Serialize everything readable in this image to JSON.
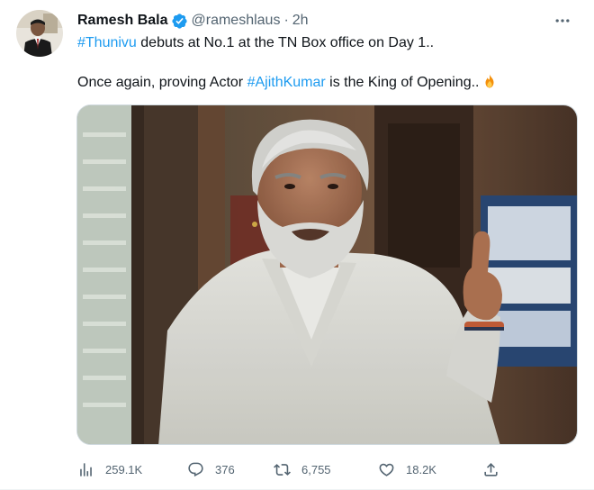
{
  "tweet": {
    "author_name": "Ramesh Bala",
    "author_handle": "@rameshlaus",
    "separator": "·",
    "timestamp": "2h",
    "verified": true,
    "text_line1": {
      "hashtag": "#Thunivu",
      "rest": " debuts at No.1 at the TN Box office on Day 1.."
    },
    "text_line2": {
      "prefix": "Once again, proving Actor ",
      "hashtag": "#AjithKumar",
      "suffix": " is the King of Opening.."
    },
    "emoji": "fire-emoji",
    "media": {
      "kind": "photo"
    },
    "stats": {
      "views": "259.1K",
      "replies": "376",
      "retweets": "6,755",
      "likes": "18.2K"
    }
  },
  "icons": {
    "verified": "verified-badge-icon",
    "more": "more-options-icon",
    "views": "views-chart-icon",
    "reply": "reply-bubble-icon",
    "retweet": "retweet-icon",
    "like": "heart-icon",
    "share": "share-icon"
  },
  "colors": {
    "link": "#1d9bf0",
    "secondary_text": "#536471",
    "primary_text": "#0f1419",
    "verified": "#1d9bf0"
  }
}
